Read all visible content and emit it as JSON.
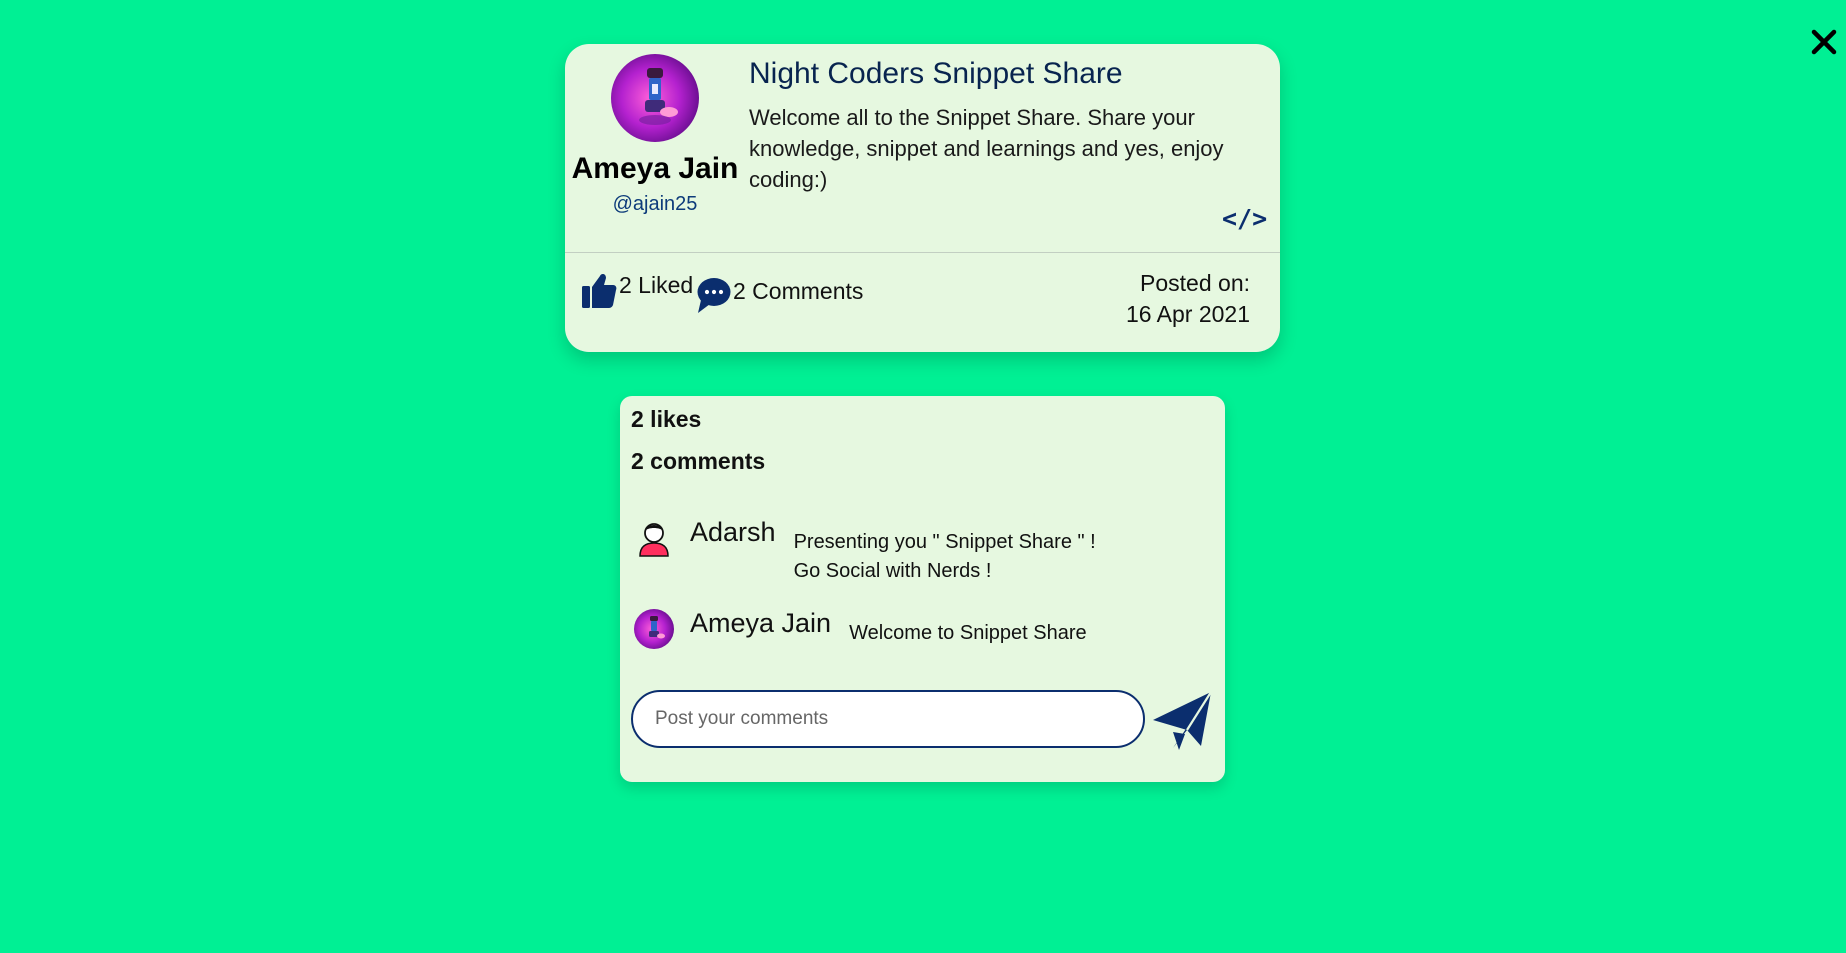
{
  "close": {
    "icon": "close-icon"
  },
  "post": {
    "author": {
      "name": "Ameya Jain",
      "handle": "@ajain25",
      "avatar_icon": "avatar-photo"
    },
    "title": "Night Coders Snippet Share",
    "body": "Welcome all to the Snippet Share. Share your knowledge, snippet and learnings and yes, enjoy coding:)",
    "code_label": "</>",
    "likes_label": "2 Liked",
    "comments_label": "2 Comments",
    "posted_on_label": "Posted on:",
    "posted_on_date": "16 Apr 2021"
  },
  "details": {
    "likes_count": "2 likes",
    "comments_count": "2 comments",
    "comments": [
      {
        "user": "Adarsh",
        "text_line1": "Presenting you \" Snippet Share \" !",
        "text_line2": "Go Social with Nerds !",
        "avatar_icon": "default-user-icon"
      },
      {
        "user": "Ameya Jain",
        "text_line1": "Welcome to Snippet Share",
        "avatar_icon": "avatar-photo"
      }
    ],
    "input": {
      "placeholder": "Post your comments",
      "value": ""
    },
    "send_icon": "paper-plane-icon"
  },
  "colors": {
    "background": "#00f094",
    "card": "#e6f8e0",
    "accent": "#0b2e6e",
    "avatar_magenta": "#b21fd1"
  }
}
